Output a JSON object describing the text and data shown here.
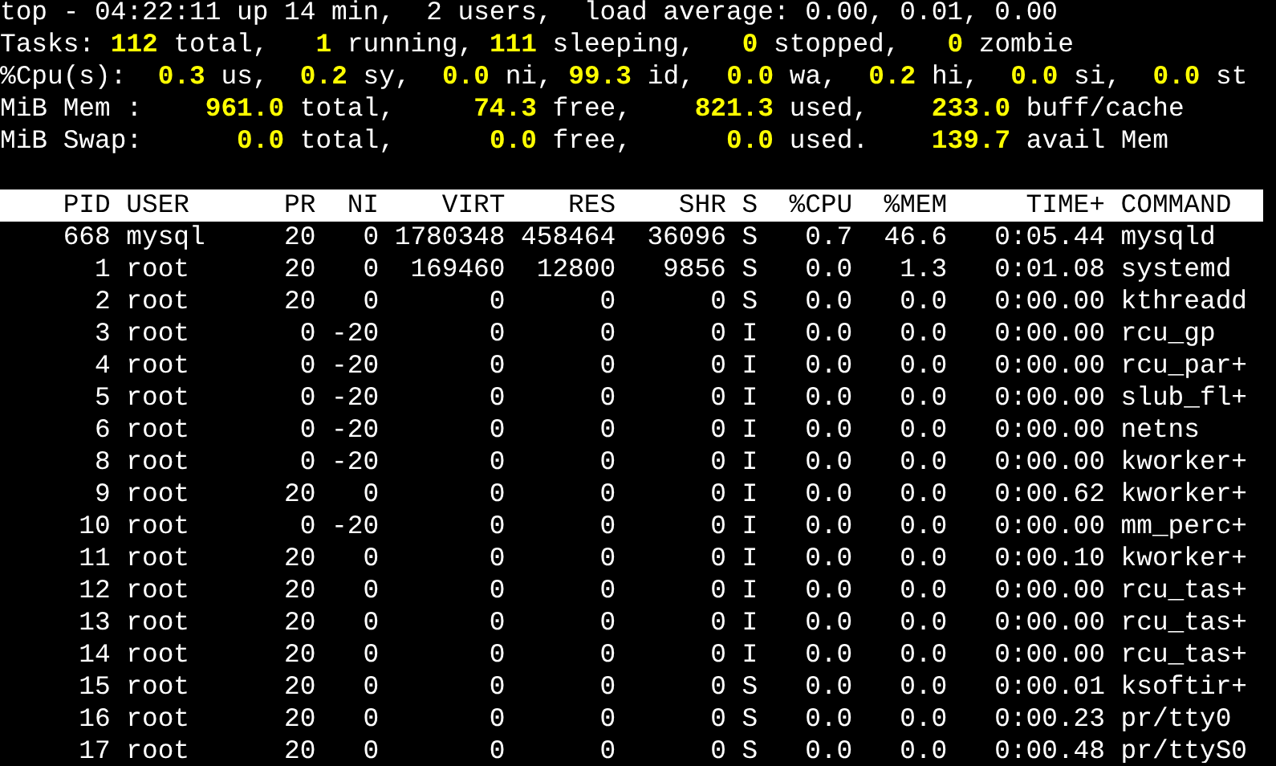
{
  "uptime_line": "top - 04:22:11 up 14 min,  2 users,  load average: 0.00, 0.01, 0.00",
  "summary": [
    {
      "label": "Tasks:",
      "stats": [
        "**112** total,",
        "**1** running,",
        "**111** sleeping,",
        "**0** stopped,",
        "**0** zombie"
      ]
    },
    {
      "label": "%Cpu(s):",
      "stats": [
        "**0.3** us,",
        "**0.2** sy,",
        "**0.0** ni,",
        "**99.3** id,",
        "**0.0** wa,",
        "**0.2** hi,",
        "**0.0** si,",
        "**0.0** st"
      ]
    },
    {
      "label": "MiB Mem :",
      "stats": [
        "**961.0** total,",
        "**74.3** free,",
        "**821.3** used,",
        "**233.0** buff/cache"
      ]
    },
    {
      "label": "MiB Swap:",
      "stats": [
        "**0.0** total,",
        "**0.0** free,",
        "**0.0** used.",
        "**139.7** avail Mem"
      ]
    }
  ],
  "table": {
    "columns": [
      "PID",
      "USER",
      "PR",
      "NI",
      "VIRT",
      "RES",
      "SHR",
      "S",
      "%CPU",
      "%MEM",
      "TIME+",
      "COMMAND"
    ],
    "rows": [
      [
        "668",
        "mysql",
        "20",
        "0",
        "1780348",
        "458464",
        "36096",
        "S",
        "0.7",
        "46.6",
        "0:05.44",
        "mysqld"
      ],
      [
        "1",
        "root",
        "20",
        "0",
        "169460",
        "12800",
        "9856",
        "S",
        "0.0",
        "1.3",
        "0:01.08",
        "systemd"
      ],
      [
        "2",
        "root",
        "20",
        "0",
        "0",
        "0",
        "0",
        "S",
        "0.0",
        "0.0",
        "0:00.00",
        "kthreadd"
      ],
      [
        "3",
        "root",
        "0",
        "-20",
        "0",
        "0",
        "0",
        "I",
        "0.0",
        "0.0",
        "0:00.00",
        "rcu_gp"
      ],
      [
        "4",
        "root",
        "0",
        "-20",
        "0",
        "0",
        "0",
        "I",
        "0.0",
        "0.0",
        "0:00.00",
        "rcu_par+"
      ],
      [
        "5",
        "root",
        "0",
        "-20",
        "0",
        "0",
        "0",
        "I",
        "0.0",
        "0.0",
        "0:00.00",
        "slub_fl+"
      ],
      [
        "6",
        "root",
        "0",
        "-20",
        "0",
        "0",
        "0",
        "I",
        "0.0",
        "0.0",
        "0:00.00",
        "netns"
      ],
      [
        "8",
        "root",
        "0",
        "-20",
        "0",
        "0",
        "0",
        "I",
        "0.0",
        "0.0",
        "0:00.00",
        "kworker+"
      ],
      [
        "9",
        "root",
        "20",
        "0",
        "0",
        "0",
        "0",
        "I",
        "0.0",
        "0.0",
        "0:00.62",
        "kworker+"
      ],
      [
        "10",
        "root",
        "0",
        "-20",
        "0",
        "0",
        "0",
        "I",
        "0.0",
        "0.0",
        "0:00.00",
        "mm_perc+"
      ],
      [
        "11",
        "root",
        "20",
        "0",
        "0",
        "0",
        "0",
        "I",
        "0.0",
        "0.0",
        "0:00.10",
        "kworker+"
      ],
      [
        "12",
        "root",
        "20",
        "0",
        "0",
        "0",
        "0",
        "I",
        "0.0",
        "0.0",
        "0:00.00",
        "rcu_tas+"
      ],
      [
        "13",
        "root",
        "20",
        "0",
        "0",
        "0",
        "0",
        "I",
        "0.0",
        "0.0",
        "0:00.00",
        "rcu_tas+"
      ],
      [
        "14",
        "root",
        "20",
        "0",
        "0",
        "0",
        "0",
        "I",
        "0.0",
        "0.0",
        "0:00.00",
        "rcu_tas+"
      ],
      [
        "15",
        "root",
        "20",
        "0",
        "0",
        "0",
        "0",
        "S",
        "0.0",
        "0.0",
        "0:00.01",
        "ksoftir+"
      ],
      [
        "16",
        "root",
        "20",
        "0",
        "0",
        "0",
        "0",
        "S",
        "0.0",
        "0.0",
        "0:00.23",
        "pr/tty0"
      ],
      [
        "17",
        "root",
        "20",
        "0",
        "0",
        "0",
        "0",
        "S",
        "0.0",
        "0.0",
        "0:00.48",
        "pr/ttyS0"
      ]
    ]
  }
}
